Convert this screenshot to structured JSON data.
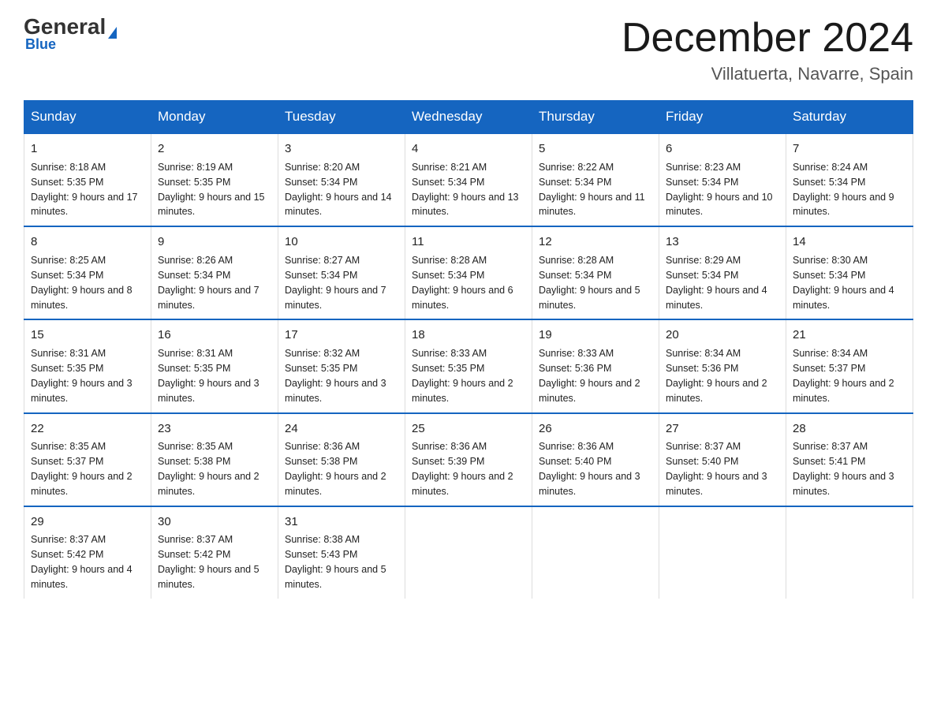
{
  "logo": {
    "general": "General",
    "triangle": "▶",
    "blue": "Blue"
  },
  "header": {
    "month_title": "December 2024",
    "location": "Villatuerta, Navarre, Spain"
  },
  "weekdays": [
    "Sunday",
    "Monday",
    "Tuesday",
    "Wednesday",
    "Thursday",
    "Friday",
    "Saturday"
  ],
  "weeks": [
    [
      {
        "day": "1",
        "sunrise": "8:18 AM",
        "sunset": "5:35 PM",
        "daylight": "9 hours and 17 minutes."
      },
      {
        "day": "2",
        "sunrise": "8:19 AM",
        "sunset": "5:35 PM",
        "daylight": "9 hours and 15 minutes."
      },
      {
        "day": "3",
        "sunrise": "8:20 AM",
        "sunset": "5:34 PM",
        "daylight": "9 hours and 14 minutes."
      },
      {
        "day": "4",
        "sunrise": "8:21 AM",
        "sunset": "5:34 PM",
        "daylight": "9 hours and 13 minutes."
      },
      {
        "day": "5",
        "sunrise": "8:22 AM",
        "sunset": "5:34 PM",
        "daylight": "9 hours and 11 minutes."
      },
      {
        "day": "6",
        "sunrise": "8:23 AM",
        "sunset": "5:34 PM",
        "daylight": "9 hours and 10 minutes."
      },
      {
        "day": "7",
        "sunrise": "8:24 AM",
        "sunset": "5:34 PM",
        "daylight": "9 hours and 9 minutes."
      }
    ],
    [
      {
        "day": "8",
        "sunrise": "8:25 AM",
        "sunset": "5:34 PM",
        "daylight": "9 hours and 8 minutes."
      },
      {
        "day": "9",
        "sunrise": "8:26 AM",
        "sunset": "5:34 PM",
        "daylight": "9 hours and 7 minutes."
      },
      {
        "day": "10",
        "sunrise": "8:27 AM",
        "sunset": "5:34 PM",
        "daylight": "9 hours and 7 minutes."
      },
      {
        "day": "11",
        "sunrise": "8:28 AM",
        "sunset": "5:34 PM",
        "daylight": "9 hours and 6 minutes."
      },
      {
        "day": "12",
        "sunrise": "8:28 AM",
        "sunset": "5:34 PM",
        "daylight": "9 hours and 5 minutes."
      },
      {
        "day": "13",
        "sunrise": "8:29 AM",
        "sunset": "5:34 PM",
        "daylight": "9 hours and 4 minutes."
      },
      {
        "day": "14",
        "sunrise": "8:30 AM",
        "sunset": "5:34 PM",
        "daylight": "9 hours and 4 minutes."
      }
    ],
    [
      {
        "day": "15",
        "sunrise": "8:31 AM",
        "sunset": "5:35 PM",
        "daylight": "9 hours and 3 minutes."
      },
      {
        "day": "16",
        "sunrise": "8:31 AM",
        "sunset": "5:35 PM",
        "daylight": "9 hours and 3 minutes."
      },
      {
        "day": "17",
        "sunrise": "8:32 AM",
        "sunset": "5:35 PM",
        "daylight": "9 hours and 3 minutes."
      },
      {
        "day": "18",
        "sunrise": "8:33 AM",
        "sunset": "5:35 PM",
        "daylight": "9 hours and 2 minutes."
      },
      {
        "day": "19",
        "sunrise": "8:33 AM",
        "sunset": "5:36 PM",
        "daylight": "9 hours and 2 minutes."
      },
      {
        "day": "20",
        "sunrise": "8:34 AM",
        "sunset": "5:36 PM",
        "daylight": "9 hours and 2 minutes."
      },
      {
        "day": "21",
        "sunrise": "8:34 AM",
        "sunset": "5:37 PM",
        "daylight": "9 hours and 2 minutes."
      }
    ],
    [
      {
        "day": "22",
        "sunrise": "8:35 AM",
        "sunset": "5:37 PM",
        "daylight": "9 hours and 2 minutes."
      },
      {
        "day": "23",
        "sunrise": "8:35 AM",
        "sunset": "5:38 PM",
        "daylight": "9 hours and 2 minutes."
      },
      {
        "day": "24",
        "sunrise": "8:36 AM",
        "sunset": "5:38 PM",
        "daylight": "9 hours and 2 minutes."
      },
      {
        "day": "25",
        "sunrise": "8:36 AM",
        "sunset": "5:39 PM",
        "daylight": "9 hours and 2 minutes."
      },
      {
        "day": "26",
        "sunrise": "8:36 AM",
        "sunset": "5:40 PM",
        "daylight": "9 hours and 3 minutes."
      },
      {
        "day": "27",
        "sunrise": "8:37 AM",
        "sunset": "5:40 PM",
        "daylight": "9 hours and 3 minutes."
      },
      {
        "day": "28",
        "sunrise": "8:37 AM",
        "sunset": "5:41 PM",
        "daylight": "9 hours and 3 minutes."
      }
    ],
    [
      {
        "day": "29",
        "sunrise": "8:37 AM",
        "sunset": "5:42 PM",
        "daylight": "9 hours and 4 minutes."
      },
      {
        "day": "30",
        "sunrise": "8:37 AM",
        "sunset": "5:42 PM",
        "daylight": "9 hours and 5 minutes."
      },
      {
        "day": "31",
        "sunrise": "8:38 AM",
        "sunset": "5:43 PM",
        "daylight": "9 hours and 5 minutes."
      },
      null,
      null,
      null,
      null
    ]
  ]
}
